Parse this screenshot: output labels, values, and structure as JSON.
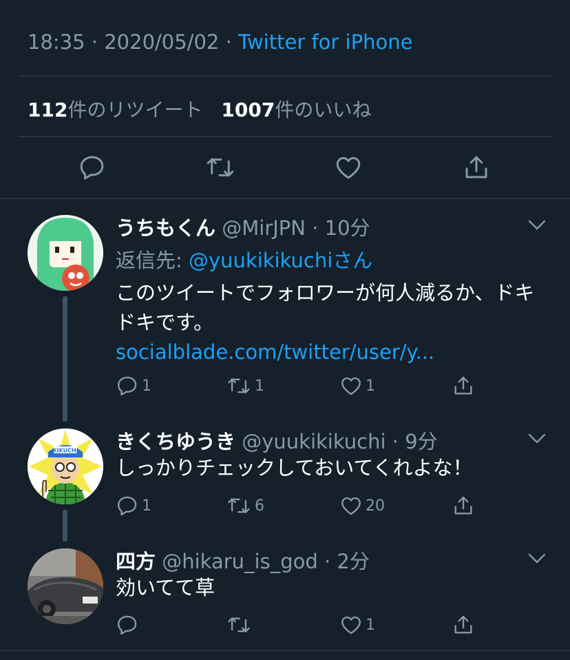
{
  "tweet_meta": {
    "time": "18:35",
    "date": "2020/05/02",
    "source": "Twitter for iPhone"
  },
  "stats": {
    "retweet_count": "112",
    "retweet_label": "件のリツイート",
    "like_count": "1007",
    "like_label": "件のいいね"
  },
  "replies": [
    {
      "name": "うちもくん",
      "handle": "@MirJPN",
      "time": "10分",
      "reply_to_prefix": "返信先: ",
      "reply_to_handle": "@yuukikikuchi",
      "reply_to_suffix": "さん",
      "text": "このツイートでフォロワーが何人減るか、ドキドキです。",
      "link": "socialblade.com/twitter/user/y...",
      "reply_count": "1",
      "retweet_count": "1",
      "like_count": "1"
    },
    {
      "name": "きくちゆうき",
      "handle": "@yuukikikuchi",
      "time": "9分",
      "text": "しっかりチェックしておいてくれよな！",
      "reply_count": "1",
      "retweet_count": "6",
      "like_count": "20"
    },
    {
      "name": "四方",
      "handle": "@hikaru_is_god",
      "time": "2分",
      "text": "効いてて草",
      "reply_count": "",
      "retweet_count": "",
      "like_count": "1"
    }
  ],
  "avatar_badge_text": "KIKUCHI",
  "icons": [
    "reply-icon",
    "retweet-icon",
    "like-icon",
    "share-icon",
    "chevron-down-icon"
  ],
  "colors": {
    "background": "#15202b",
    "accent": "#1da1f2",
    "secondary_text": "#8899a6",
    "divider": "#38444d"
  }
}
